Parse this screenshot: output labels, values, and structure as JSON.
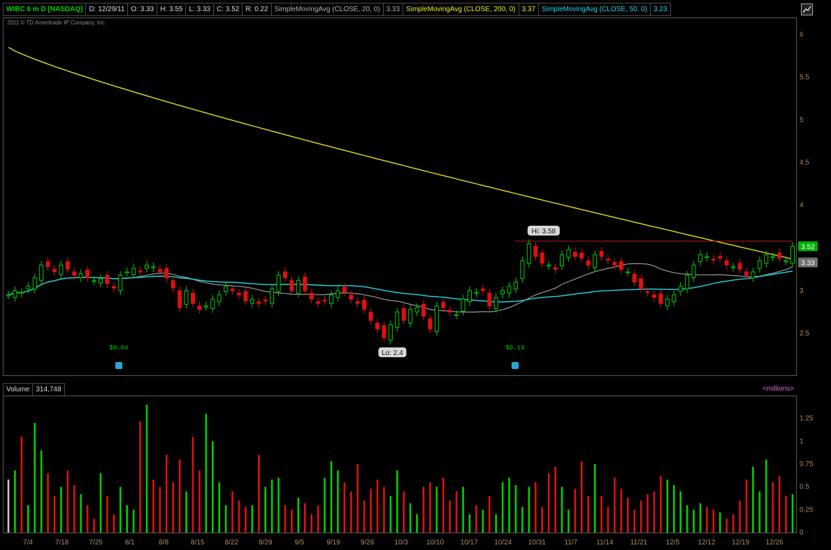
{
  "header": {
    "symbol": "WIBC 6 m D [NASDAQ]",
    "date": "D: 12/29/11",
    "open": "O: 3.33",
    "high": "H: 3.55",
    "low": "L: 3.33",
    "close": "C: 3.52",
    "range": "R: 0.22",
    "sma20_label": "SimpleMovingAvg (CLOSE, 20, 0)",
    "sma20_value": "3.33",
    "sma200_label": "SimpleMovingAvg (CLOSE, 200, 0)",
    "sma200_value": "3.37",
    "sma50_label": "SimpleMovingAvg (CLOSE, 50, 0)",
    "sma50_value": "3.23"
  },
  "copyright": "2011 © TD Ameritrade IP Company, Inc.",
  "volume_header": {
    "label": "Volume",
    "value": "314,748",
    "units": "<millions>"
  },
  "colors": {
    "up": "#00d000",
    "down": "#e01010",
    "neutral": "#c8c8c8",
    "sma20": "#9a9a9a",
    "sma50": "#22d8e8",
    "sma200": "#e0e020",
    "hi_line": "#c01818",
    "axis_text": "#b08a6a"
  },
  "annotations": {
    "hi_label": "Hi: 3.58",
    "lo_label": "Lo: 2.4",
    "last_price_badge": "3.52",
    "sma20_badge": "3.33",
    "dividend_1": "$0.04",
    "dividend_2": "$0.14"
  },
  "chart_data": {
    "type": "candlestick",
    "price_axis": {
      "ticks": [
        "6",
        "5.5",
        "5",
        "4.5",
        "4",
        "3.5",
        "3",
        "2.5"
      ],
      "ylim": [
        2.0,
        6.2
      ]
    },
    "volume_axis": {
      "ticks": [
        "1.25",
        "1",
        "0.75",
        "0.5",
        "0.25",
        "0"
      ],
      "ylim": [
        0,
        1.5
      ]
    },
    "x_labels": [
      "7/4",
      "7/18",
      "7/25",
      "8/1",
      "8/8",
      "8/15",
      "8/22",
      "8/29",
      "9/5",
      "9/19",
      "9/26",
      "10/3",
      "10/10",
      "10/17",
      "10/24",
      "10/31",
      "11/7",
      "11/14",
      "11/21",
      "12/5",
      "12/12",
      "12/19",
      "12/26"
    ],
    "hi": 3.58,
    "lo": 2.4,
    "closes": [
      2.95,
      3.0,
      2.98,
      3.05,
      3.15,
      3.3,
      3.28,
      3.22,
      3.3,
      3.25,
      3.18,
      3.2,
      3.15,
      3.12,
      3.14,
      3.08,
      3.03,
      3.18,
      3.22,
      3.26,
      3.22,
      3.3,
      3.28,
      3.22,
      3.15,
      3.03,
      2.8,
      3.0,
      2.85,
      2.78,
      2.82,
      2.9,
      2.95,
      3.05,
      3.0,
      2.95,
      2.88,
      2.9,
      2.85,
      2.88,
      3.02,
      3.18,
      3.15,
      3.0,
      3.12,
      3.0,
      2.9,
      2.85,
      2.88,
      2.95,
      3.0,
      2.98,
      2.9,
      2.85,
      2.78,
      2.65,
      2.55,
      2.45,
      2.6,
      2.75,
      2.65,
      2.78,
      2.8,
      2.7,
      2.55,
      2.82,
      2.8,
      2.75,
      2.72,
      2.9,
      3.0,
      2.98,
      3.0,
      2.82,
      2.92,
      3.0,
      3.05,
      3.1,
      3.35,
      3.55,
      3.4,
      3.32,
      3.3,
      3.25,
      3.42,
      3.48,
      3.4,
      3.38,
      3.3,
      3.42,
      3.4,
      3.36,
      3.3,
      3.25,
      3.22,
      3.1,
      3.02,
      2.98,
      2.92,
      2.85,
      2.9,
      2.95,
      3.05,
      3.18,
      3.3,
      3.42,
      3.4,
      3.36,
      3.38,
      3.3,
      3.28,
      3.25,
      3.18,
      3.22,
      3.35,
      3.42,
      3.4,
      3.38,
      3.35,
      3.52
    ],
    "volumes": [
      0.58,
      0.68,
      1.05,
      0.3,
      1.2,
      0.9,
      0.65,
      0.4,
      0.5,
      0.68,
      0.52,
      0.42,
      0.3,
      0.15,
      0.65,
      0.4,
      0.2,
      0.5,
      0.3,
      0.25,
      1.22,
      1.4,
      0.58,
      0.5,
      0.85,
      0.55,
      0.8,
      0.45,
      1.05,
      0.68,
      1.3,
      1.0,
      0.55,
      0.3,
      0.45,
      0.35,
      0.28,
      0.3,
      0.85,
      0.5,
      0.58,
      0.6,
      0.3,
      0.25,
      0.38,
      0.32,
      0.2,
      0.3,
      0.6,
      0.78,
      0.68,
      0.55,
      0.45,
      0.75,
      0.35,
      0.48,
      0.58,
      0.5,
      0.4,
      0.68,
      0.45,
      0.32,
      0.2,
      0.5,
      0.55,
      0.5,
      0.6,
      0.35,
      0.45,
      0.5,
      0.2,
      0.3,
      0.25,
      0.4,
      0.2,
      0.55,
      0.6,
      0.52,
      0.28,
      0.5,
      0.55,
      0.28,
      0.65,
      0.72,
      0.5,
      0.25,
      0.48,
      0.78,
      0.4,
      0.75,
      0.4,
      0.28,
      0.6,
      0.48,
      0.38,
      0.25,
      0.35,
      0.42,
      0.45,
      0.62,
      0.58,
      0.52,
      0.45,
      0.3,
      0.25,
      0.32,
      0.28,
      0.25,
      0.22,
      0.15,
      0.2,
      0.35,
      0.58,
      0.72,
      0.45,
      0.8,
      0.55,
      0.62,
      0.4,
      0.42,
      0.25,
      0.3
    ]
  }
}
